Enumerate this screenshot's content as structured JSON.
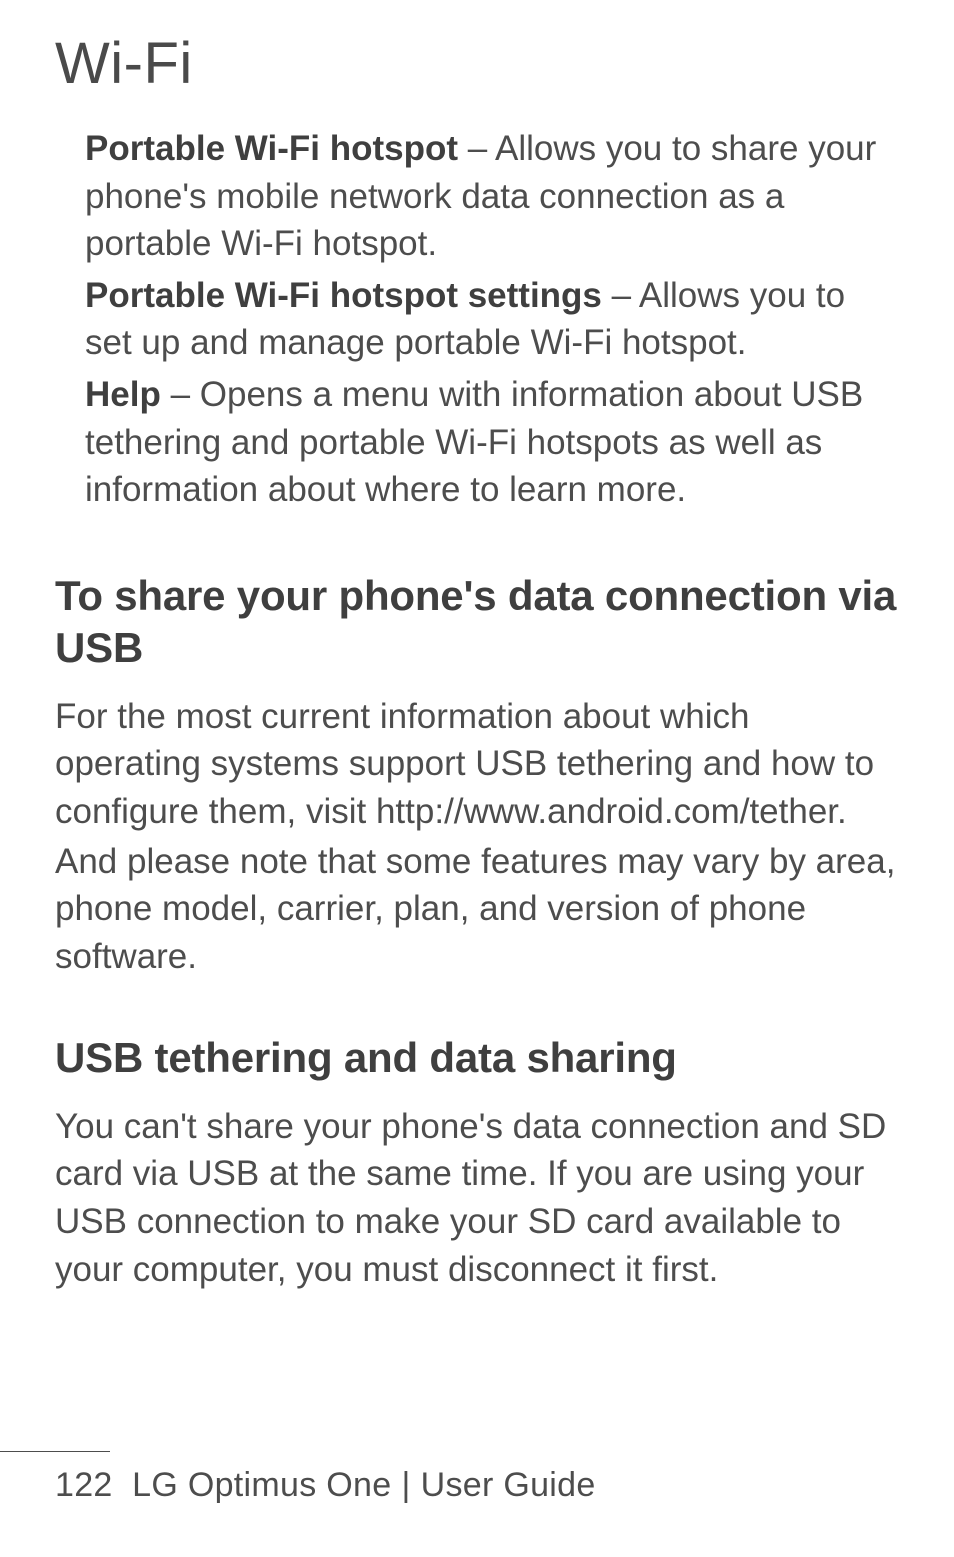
{
  "chapterTitle": "Wi-Fi",
  "definitions": [
    {
      "term": "Portable Wi-Fi hotspot",
      "desc": " – Allows you to share your phone's mobile network data connection as a portable Wi-Fi hotspot."
    },
    {
      "term": "Portable Wi-Fi hotspot settings",
      "desc": " – Allows you to set up and manage portable Wi-Fi hotspot."
    },
    {
      "term": "Help",
      "desc": " – Opens a menu with information about USB tethering and portable Wi-Fi hotspots as well as information about where to learn more."
    }
  ],
  "sections": [
    {
      "heading": "To share your phone's data connection via USB",
      "paragraphs": [
        "For the most current information about which operating systems support USB tethering and how to configure them, visit http://www.android.com/tether.",
        "And please note that some features may vary by area, phone model, carrier, plan, and version of phone software."
      ]
    },
    {
      "heading": "USB tethering and data sharing",
      "paragraphs": [
        "You can't share your phone's data connection and SD card via USB at the same time. If you are using your USB connection to make your SD card available to your computer, you must disconnect it first."
      ]
    }
  ],
  "footer": {
    "pageNumber": "122",
    "product": "LG Optimus One",
    "docType": "User Guide",
    "divider": "|"
  }
}
